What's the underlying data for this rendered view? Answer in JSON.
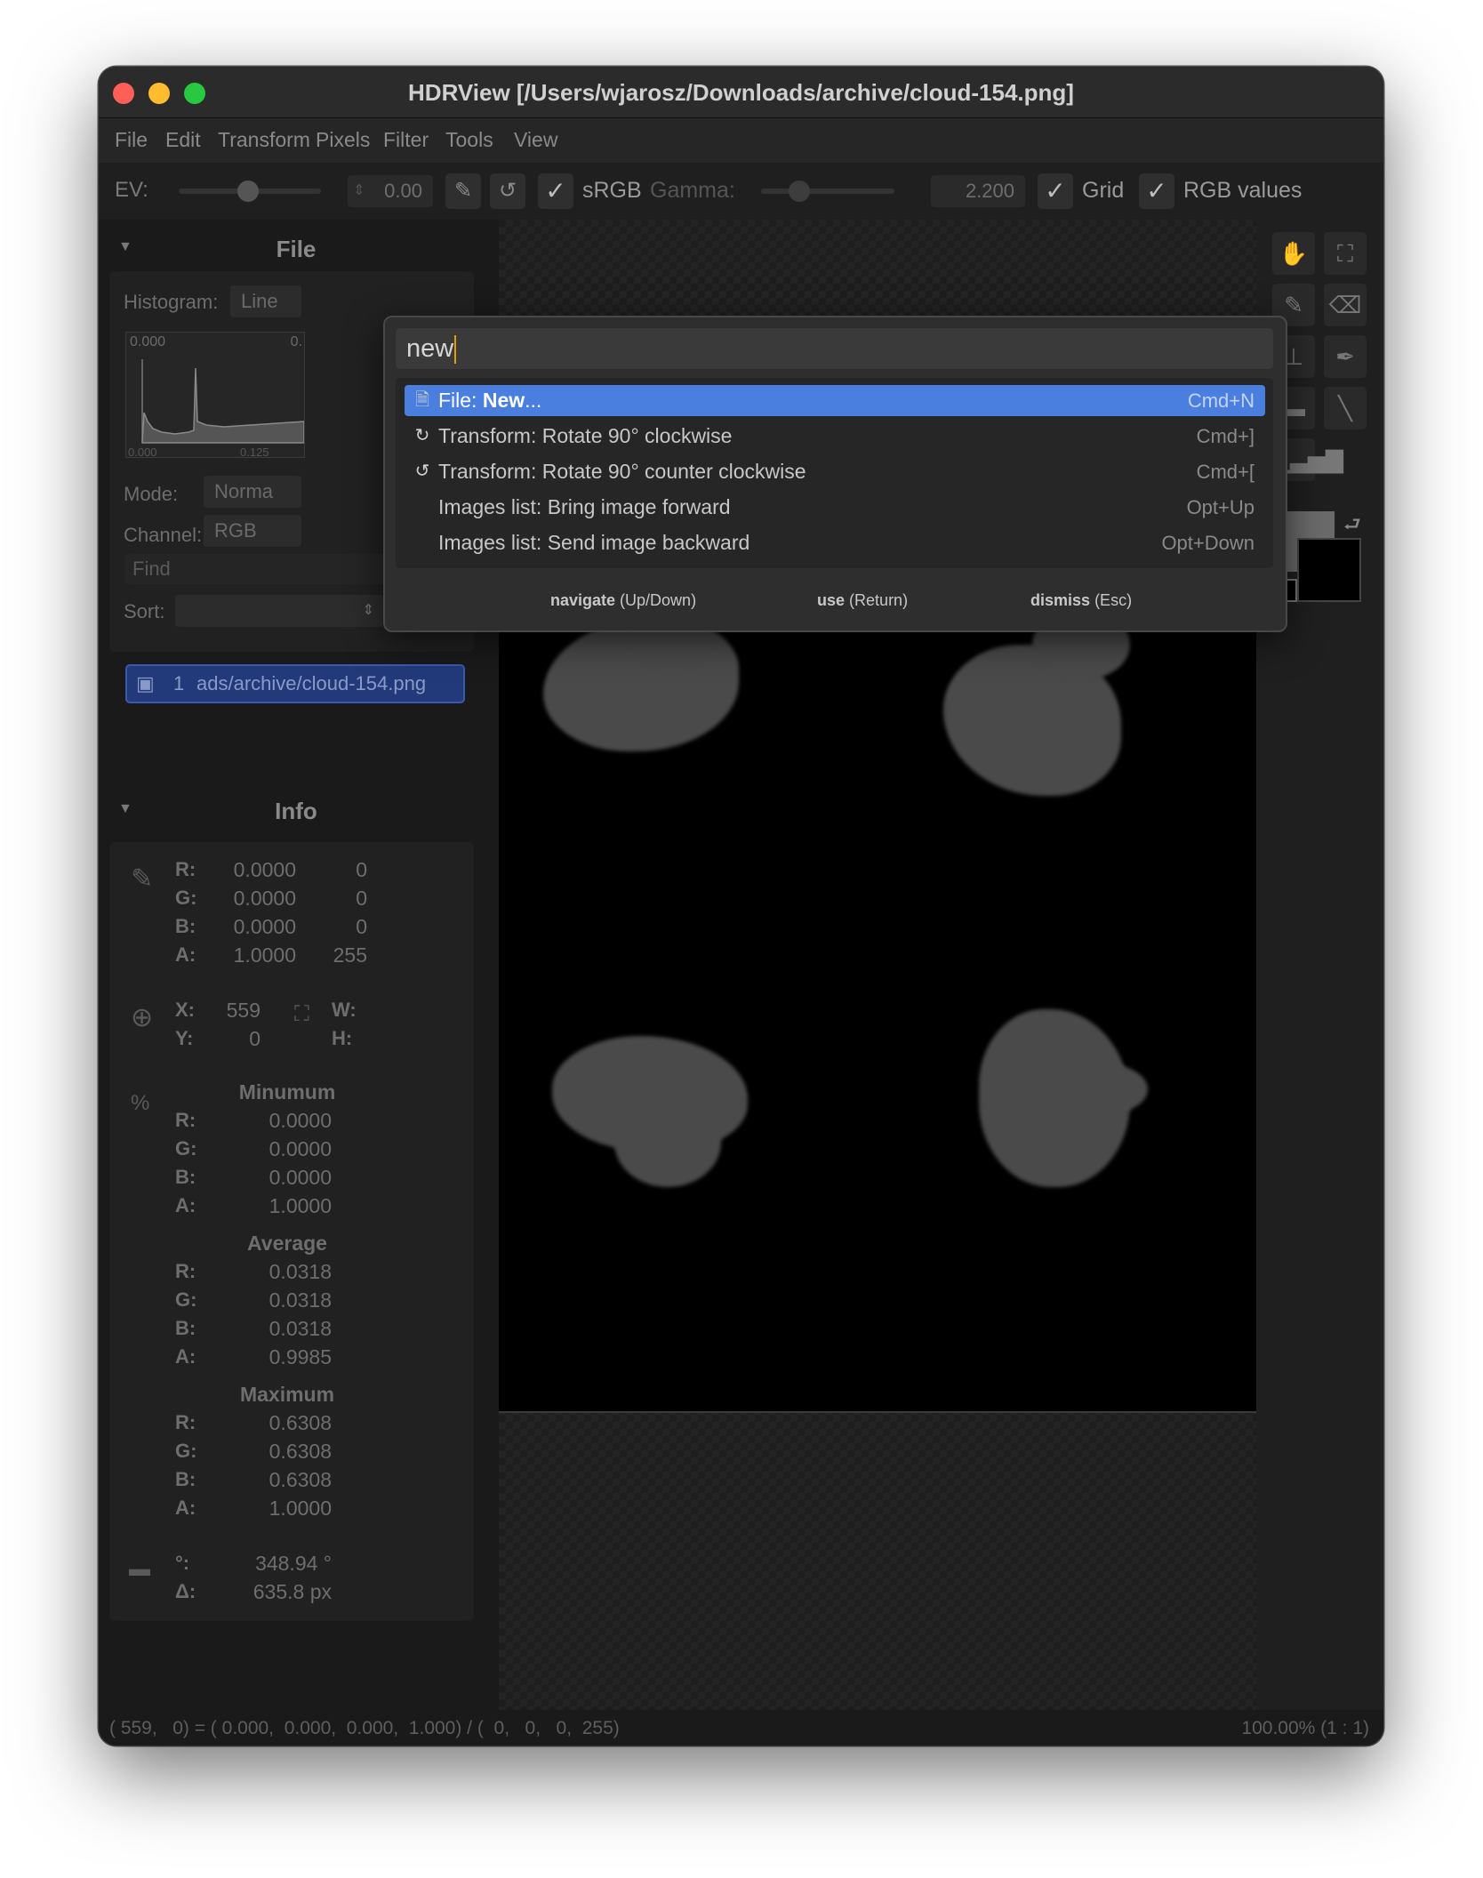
{
  "window": {
    "title": "HDRView [/Users/wjarosz/Downloads/archive/cloud-154.png]"
  },
  "menu": [
    "File",
    "Edit",
    "Transform",
    "Pixels",
    "Filter",
    "Tools",
    "View"
  ],
  "toolbar": {
    "ev_label": "EV:",
    "ev_value": "0.00",
    "srgb_label": "sRGB",
    "gamma_label": "Gamma:",
    "gamma_value": "2.200",
    "grid_label": "Grid",
    "rgb_values_label": "RGB values"
  },
  "files_panel": {
    "header": "File",
    "histogram_label": "Histogram:",
    "histogram_mode": "Line",
    "hist_top_left": "0.000",
    "hist_top_right": "0.",
    "hist_bottom_left": "0.000",
    "hist_bottom_mid": "0.125",
    "mode_label": "Mode:",
    "mode_value": "Norma",
    "channel_label": "Channel:",
    "channel_value": "RGB",
    "find_placeholder": "Find",
    "regex_btn": ".*",
    "sort_label": "Sort:",
    "file_index": "1",
    "file_name": "ads/archive/cloud-154.png"
  },
  "info_panel": {
    "header": "Info",
    "pixel": [
      {
        "ch": "R:",
        "v": "0.0000",
        "i": "0"
      },
      {
        "ch": "G:",
        "v": "0.0000",
        "i": "0"
      },
      {
        "ch": "B:",
        "v": "0.0000",
        "i": "0"
      },
      {
        "ch": "A:",
        "v": "1.0000",
        "i": "255"
      }
    ],
    "x_label": "X:",
    "x_value": "559",
    "y_label": "Y:",
    "y_value": "0",
    "w_label": "W:",
    "h_label": "H:",
    "minimum": {
      "title": "Minumum",
      "rows": [
        {
          "ch": "R:",
          "v": "0.0000"
        },
        {
          "ch": "G:",
          "v": "0.0000"
        },
        {
          "ch": "B:",
          "v": "0.0000"
        },
        {
          "ch": "A:",
          "v": "1.0000"
        }
      ]
    },
    "average": {
      "title": "Average",
      "rows": [
        {
          "ch": "R:",
          "v": "0.0318"
        },
        {
          "ch": "G:",
          "v": "0.0318"
        },
        {
          "ch": "B:",
          "v": "0.0318"
        },
        {
          "ch": "A:",
          "v": "0.9985"
        }
      ]
    },
    "maximum": {
      "title": "Maximum",
      "rows": [
        {
          "ch": "R:",
          "v": "0.6308"
        },
        {
          "ch": "G:",
          "v": "0.6308"
        },
        {
          "ch": "B:",
          "v": "0.6308"
        },
        {
          "ch": "A:",
          "v": "1.0000"
        }
      ]
    },
    "angle_label": "°:",
    "angle_value": "348.94 °",
    "delta_label": "Δ:",
    "delta_value": "635.8 px"
  },
  "palette": {
    "query": "new",
    "items": [
      {
        "icon": "file-icon",
        "glyph": "🗎",
        "pre": "File: ",
        "bold": "New",
        "post": "...",
        "shortcut": "Cmd+N",
        "selected": true
      },
      {
        "icon": "rotate-cw-icon",
        "glyph": "↻",
        "text": "Transform: Rotate 90° clockwise",
        "shortcut": "Cmd+]",
        "selected": false
      },
      {
        "icon": "rotate-ccw-icon",
        "glyph": "↺",
        "text": "Transform: Rotate 90° counter clockwise",
        "shortcut": "Cmd+[",
        "selected": false
      },
      {
        "icon": "",
        "glyph": "",
        "text": "Images list: Bring image forward",
        "shortcut": "Opt+Up",
        "selected": false
      },
      {
        "icon": "",
        "glyph": "",
        "text": "Images list: Send image backward",
        "shortcut": "Opt+Down",
        "selected": false
      }
    ],
    "hint_navigate_key": "navigate",
    "hint_navigate_val": "(Up/Down)",
    "hint_use_key": "use",
    "hint_use_val": "(Return)",
    "hint_dismiss_key": "dismiss",
    "hint_dismiss_val": "(Esc)"
  },
  "status": {
    "left": "( 559,   0) = ( 0.000,  0.000,  0.000,  1.000) / (  0,   0,   0,  255)",
    "right": "100.00% (1 : 1)"
  },
  "colors": {
    "accent": "#4a7fe0",
    "selection": "#233a7a"
  }
}
